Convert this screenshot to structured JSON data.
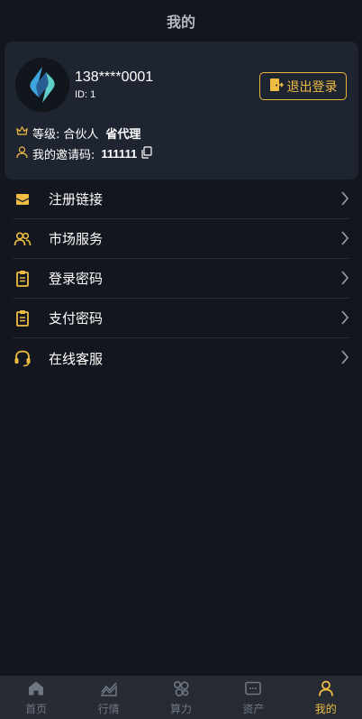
{
  "header": {
    "title": "我的"
  },
  "profile": {
    "phone": "138****0001",
    "id_text": "ID: 1",
    "logout_label": "退出登录",
    "level_label": "等级:",
    "level_value": "合伙人",
    "level_rank": "省代理",
    "invite_label": "我的邀请码:",
    "invite_code": "111111"
  },
  "menu": {
    "items": [
      {
        "label": "注册链接",
        "icon": "envelope-icon"
      },
      {
        "label": "市场服务",
        "icon": "users-icon"
      },
      {
        "label": "登录密码",
        "icon": "clipboard-icon"
      },
      {
        "label": "支付密码",
        "icon": "clipboard-icon"
      },
      {
        "label": "在线客服",
        "icon": "headset-icon"
      }
    ]
  },
  "tabbar": {
    "tabs": [
      {
        "label": "首页",
        "icon": "home-icon",
        "active": false
      },
      {
        "label": "行情",
        "icon": "chart-icon",
        "active": false
      },
      {
        "label": "算力",
        "icon": "hashrate-icon",
        "active": false
      },
      {
        "label": "资产",
        "icon": "wallet-icon",
        "active": false
      },
      {
        "label": "我的",
        "icon": "user-icon",
        "active": true
      }
    ]
  },
  "colors": {
    "accent": "#efbd42",
    "card": "#1f2530",
    "background": "#13161e",
    "tabbar": "#262b34"
  }
}
